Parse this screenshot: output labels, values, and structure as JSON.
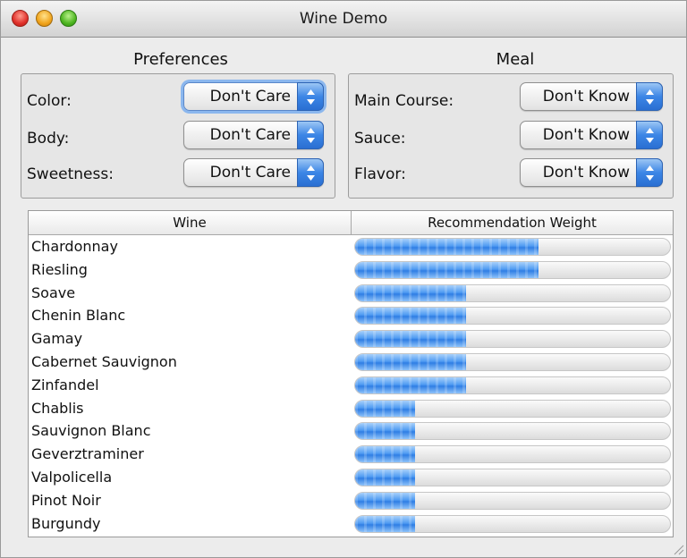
{
  "window": {
    "title": "Wine Demo"
  },
  "preferences": {
    "title": "Preferences",
    "fields": [
      {
        "label": "Color:",
        "value": "Don't Care"
      },
      {
        "label": "Body:",
        "value": "Don't Care"
      },
      {
        "label": "Sweetness:",
        "value": "Don't Care"
      }
    ]
  },
  "meal": {
    "title": "Meal",
    "fields": [
      {
        "label": "Main Course:",
        "value": "Don't Know"
      },
      {
        "label": "Sauce:",
        "value": "Don't Know"
      },
      {
        "label": "Flavor:",
        "value": "Don't Know"
      }
    ]
  },
  "table": {
    "columns": [
      "Wine",
      "Recommendation Weight"
    ],
    "rows": [
      {
        "wine": "Chardonnay",
        "weight": 0.58
      },
      {
        "wine": "Riesling",
        "weight": 0.58
      },
      {
        "wine": "Soave",
        "weight": 0.35
      },
      {
        "wine": "Chenin Blanc",
        "weight": 0.35
      },
      {
        "wine": "Gamay",
        "weight": 0.35
      },
      {
        "wine": "Cabernet Sauvignon",
        "weight": 0.35
      },
      {
        "wine": "Zinfandel",
        "weight": 0.35
      },
      {
        "wine": "Chablis",
        "weight": 0.19
      },
      {
        "wine": "Sauvignon Blanc",
        "weight": 0.19
      },
      {
        "wine": "Geverztraminer",
        "weight": 0.19
      },
      {
        "wine": "Valpolicella",
        "weight": 0.19
      },
      {
        "wine": "Pinot Noir",
        "weight": 0.19
      },
      {
        "wine": "Burgundy",
        "weight": 0.19
      }
    ]
  },
  "colors": {
    "bar_fill": "#3c86e6",
    "popup_accent": "#3c86e6",
    "focus_ring": "#8bb7ee"
  }
}
